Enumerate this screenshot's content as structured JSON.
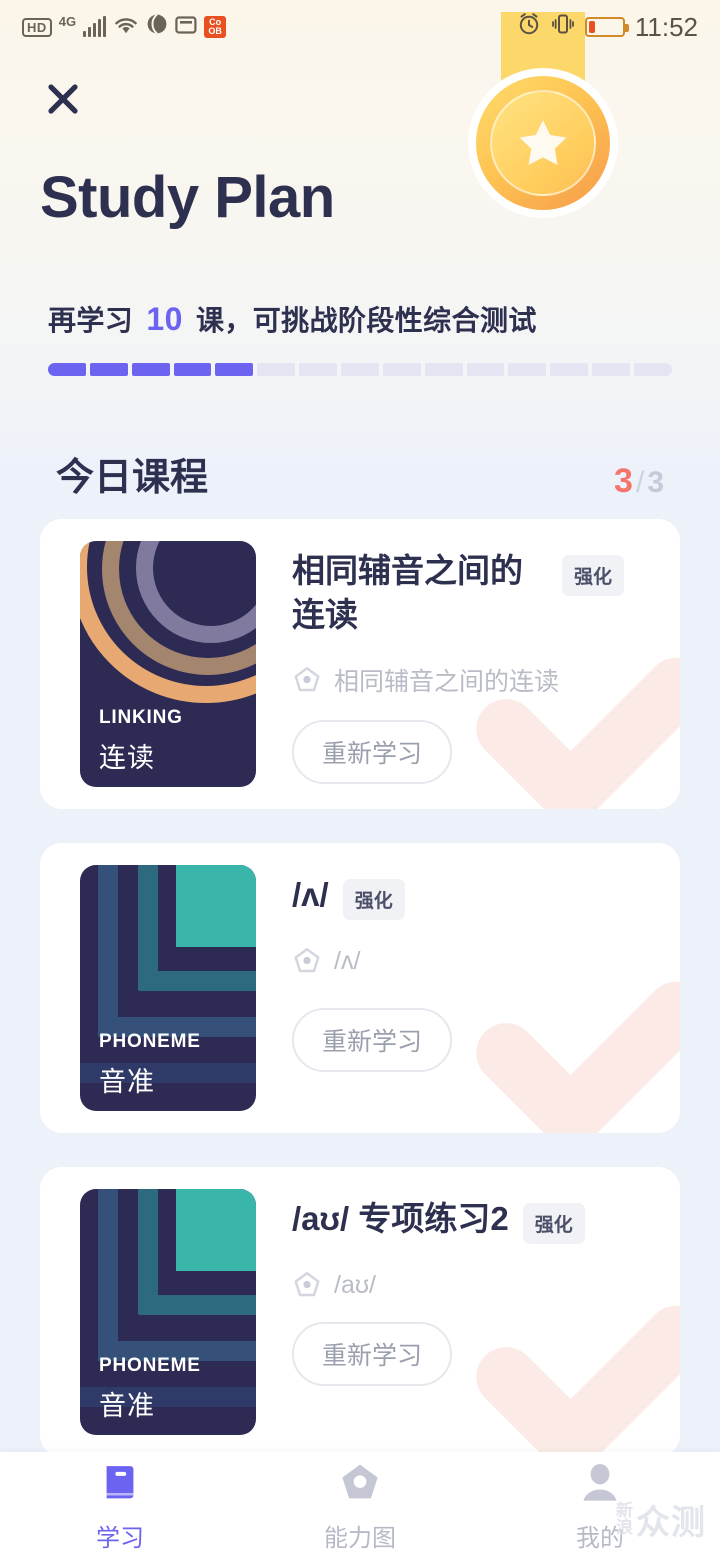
{
  "statusbar": {
    "hd": "HD",
    "network": "4G",
    "time": "11:52",
    "app_badge_top": "Co",
    "app_badge_bottom": "OB",
    "icons": [
      "hd-badge-icon",
      "signal-bars-icon",
      "wifi-icon",
      "globe-icon",
      "sim-icon",
      "app-badge-icon",
      "alarm-icon",
      "vibrate-icon",
      "battery-icon"
    ]
  },
  "header": {
    "close_label": "×",
    "title": "Study Plan",
    "medal_icon": "star-medal-icon"
  },
  "progress": {
    "prefix": "再学习",
    "count": "10",
    "suffix": "课，可挑战阶段性综合测试",
    "segments_total": 15,
    "segments_done": 5,
    "fill_color": "#6c63f0",
    "empty_color": "#e4e5f3"
  },
  "section": {
    "title": "今日课程",
    "completed": "3",
    "separator": "/",
    "total": "3",
    "done_color": "#f4766a"
  },
  "cards": [
    {
      "thumb_style": "linking",
      "thumb_label": "LINKING",
      "thumb_cn": "连读",
      "title": "相同辅音之间的连读",
      "tag": "强化",
      "subtitle": "相同辅音之间的连读",
      "button": "重新学习",
      "sub_icon": "gem-pentagon-icon",
      "watermark_icon": "check-mark-icon"
    },
    {
      "thumb_style": "phoneme",
      "thumb_label": "PHONEME",
      "thumb_cn": "音准",
      "title": "/ʌ/",
      "tag": "强化",
      "subtitle": "/ʌ/",
      "button": "重新学习",
      "sub_icon": "gem-pentagon-icon",
      "watermark_icon": "check-mark-icon"
    },
    {
      "thumb_style": "phoneme",
      "thumb_label": "PHONEME",
      "thumb_cn": "音准",
      "title": "/aʊ/ 专项练习2",
      "tag": "强化",
      "subtitle": "/aʊ/",
      "button": "重新学习",
      "sub_icon": "gem-pentagon-icon",
      "watermark_icon": "check-mark-icon"
    }
  ],
  "bottomnav": {
    "items": [
      {
        "label": "学习",
        "icon": "book-icon",
        "active": true
      },
      {
        "label": "能力图",
        "icon": "gem-icon",
        "active": false
      },
      {
        "label": "我的",
        "icon": "person-icon",
        "active": false
      }
    ]
  },
  "watermark": {
    "small_top": "新",
    "small_bottom": "浪",
    "big": "众测"
  }
}
